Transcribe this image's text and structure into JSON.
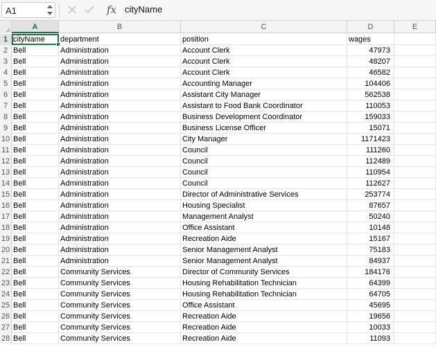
{
  "formula_bar": {
    "name_box": "A1",
    "fx_label": "fx",
    "formula_value": "cityName"
  },
  "grid": {
    "columns": [
      "A",
      "B",
      "C",
      "D",
      "E"
    ],
    "selected_column": "A",
    "selected_row": 1,
    "rows": [
      {
        "num": "1",
        "a": "cityName",
        "b": "department",
        "c": "position",
        "d": "wages"
      },
      {
        "num": "2",
        "a": "Bell",
        "b": "Administration",
        "c": "Account Clerk",
        "d": "47973"
      },
      {
        "num": "3",
        "a": "Bell",
        "b": "Administration",
        "c": "Account Clerk",
        "d": "48207"
      },
      {
        "num": "4",
        "a": "Bell",
        "b": "Administration",
        "c": "Account Clerk",
        "d": "46582"
      },
      {
        "num": "5",
        "a": "Bell",
        "b": "Administration",
        "c": "Accounting Manager",
        "d": "104406"
      },
      {
        "num": "6",
        "a": "Bell",
        "b": "Administration",
        "c": "Assistant City Manager",
        "d": "562538"
      },
      {
        "num": "7",
        "a": "Bell",
        "b": "Administration",
        "c": "Assistant to Food Bank Coordinator",
        "d": "110053"
      },
      {
        "num": "8",
        "a": "Bell",
        "b": "Administration",
        "c": "Business Development Coordinator",
        "d": "159033"
      },
      {
        "num": "9",
        "a": "Bell",
        "b": "Administration",
        "c": "Business License Officer",
        "d": "15071"
      },
      {
        "num": "10",
        "a": "Bell",
        "b": "Administration",
        "c": "City Manager",
        "d": "1171423"
      },
      {
        "num": "11",
        "a": "Bell",
        "b": "Administration",
        "c": "Council",
        "d": "111260"
      },
      {
        "num": "12",
        "a": "Bell",
        "b": "Administration",
        "c": "Council",
        "d": "112489"
      },
      {
        "num": "13",
        "a": "Bell",
        "b": "Administration",
        "c": "Council",
        "d": "110954"
      },
      {
        "num": "14",
        "a": "Bell",
        "b": "Administration",
        "c": "Council",
        "d": "112627"
      },
      {
        "num": "15",
        "a": "Bell",
        "b": "Administration",
        "c": "Director of Administrative Services",
        "d": "253774"
      },
      {
        "num": "16",
        "a": "Bell",
        "b": "Administration",
        "c": "Housing Specialist",
        "d": "87657"
      },
      {
        "num": "17",
        "a": "Bell",
        "b": "Administration",
        "c": "Management Analyst",
        "d": "50240"
      },
      {
        "num": "18",
        "a": "Bell",
        "b": "Administration",
        "c": "Office Assistant",
        "d": "10148"
      },
      {
        "num": "19",
        "a": "Bell",
        "b": "Administration",
        "c": "Recreation Aide",
        "d": "15167"
      },
      {
        "num": "20",
        "a": "Bell",
        "b": "Administration",
        "c": "Senior Management Analyst",
        "d": "75183"
      },
      {
        "num": "21",
        "a": "Bell",
        "b": "Administration",
        "c": "Senior Management Analyst",
        "d": "84937"
      },
      {
        "num": "22",
        "a": "Bell",
        "b": "Community Services",
        "c": "Director of Community Services",
        "d": "184176"
      },
      {
        "num": "23",
        "a": "Bell",
        "b": "Community Services",
        "c": "Housing Rehabilitation Technician",
        "d": "64399"
      },
      {
        "num": "24",
        "a": "Bell",
        "b": "Community Services",
        "c": "Housing Rehabilitation Technician",
        "d": "64705"
      },
      {
        "num": "25",
        "a": "Bell",
        "b": "Community Services",
        "c": "Office Assistant",
        "d": "45695"
      },
      {
        "num": "26",
        "a": "Bell",
        "b": "Community Services",
        "c": "Recreation Aide",
        "d": "19656"
      },
      {
        "num": "27",
        "a": "Bell",
        "b": "Community Services",
        "c": "Recreation Aide",
        "d": "10033"
      },
      {
        "num": "28",
        "a": "Bell",
        "b": "Community Services",
        "c": "Recreation Aide",
        "d": "11093"
      }
    ]
  },
  "colors": {
    "accent": "#1e7145",
    "grid_line": "#e3e3e3",
    "header_bg": "#f3f3f3"
  },
  "icons": {
    "cancel": "x-icon",
    "confirm": "checkmark-icon",
    "function": "fx-icon"
  }
}
